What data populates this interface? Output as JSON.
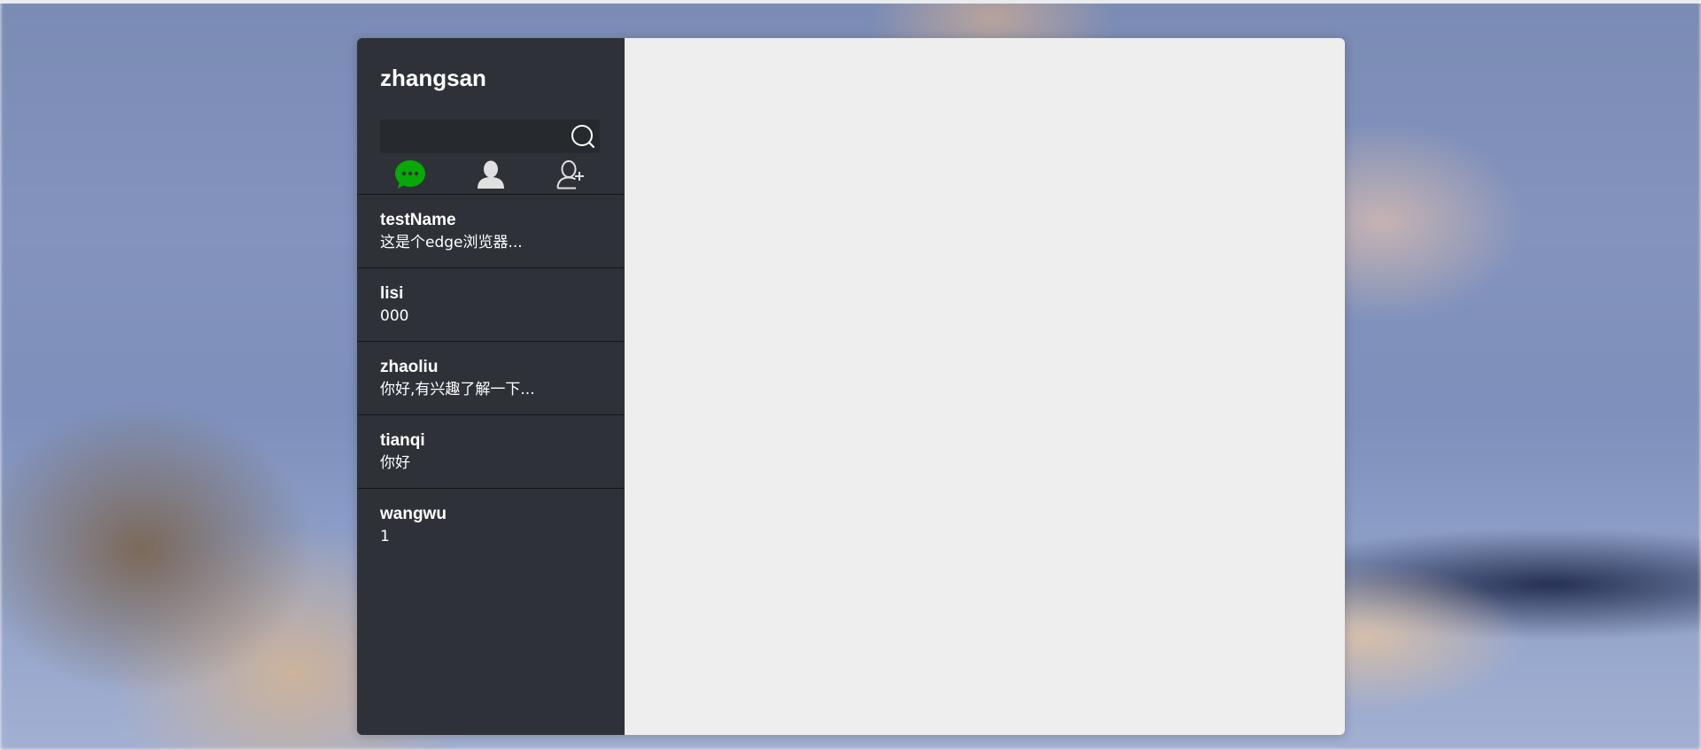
{
  "user": {
    "name": "zhangsan"
  },
  "search": {
    "value": "",
    "placeholder": ""
  },
  "tabs": [
    {
      "name": "chat",
      "icon": "chat-bubble-icon",
      "active": true,
      "color": "#08a806"
    },
    {
      "name": "contacts",
      "icon": "person-icon",
      "active": false,
      "color": "#d9d9d9"
    },
    {
      "name": "add-friend",
      "icon": "add-person-icon",
      "active": false,
      "color": "#d9d9d9"
    }
  ],
  "conversations": [
    {
      "name": "testName",
      "last_message": "这是个edge浏览器..."
    },
    {
      "name": "lisi",
      "last_message": "000"
    },
    {
      "name": "zhaoliu",
      "last_message": "你好,有兴趣了解一下..."
    },
    {
      "name": "tianqi",
      "last_message": "你好"
    },
    {
      "name": "wangwu",
      "last_message": "1"
    }
  ],
  "colors": {
    "sidebar": "#2e3238",
    "main": "#eeeeee",
    "accent": "#08a806"
  }
}
